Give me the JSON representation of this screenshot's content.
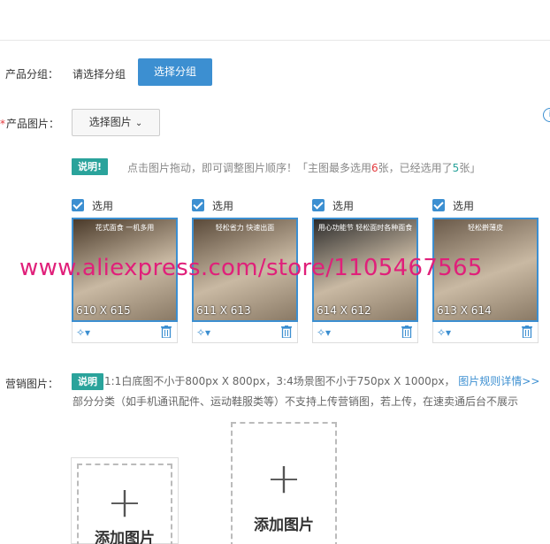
{
  "group": {
    "label": "产品分组：",
    "placeholder_text": "请选择分组",
    "select_button": "选择分组"
  },
  "images": {
    "required_mark": "*",
    "label": "产品图片：",
    "select_button": "选择图片",
    "help_icon": "i",
    "tag": "说明!",
    "hint_prefix": "点击图片拖动，即可调整图片顺序！「主图最多选用",
    "hint_max": "6",
    "hint_mid": "张，已经选用了",
    "hint_used": "5",
    "hint_suffix": "张」",
    "items": [
      {
        "check_label": "选用",
        "dims": "610 X 615",
        "banner": "花式面食 一机多用",
        "color": "#4a3a2a"
      },
      {
        "check_label": "选用",
        "dims": "611 X 613",
        "banner": "轻松省力 快速出面",
        "color": "#5a4a3a"
      },
      {
        "check_label": "选用",
        "dims": "614 X 612",
        "banner": "用心功能节 轻松面时各种面食",
        "color": "#2a2a2a"
      },
      {
        "check_label": "选用",
        "dims": "613 X 614",
        "banner": "轻松擀薄皮",
        "color": "#6a5a4a"
      }
    ]
  },
  "watermark": "www.aliexpress.com/store/1105467565",
  "marketing": {
    "label": "营销图片：",
    "tag": "说明",
    "line1": "1:1白底图不小于800px X 800px，3:4场景图不小于750px X 1000px，",
    "rules_link": "图片规则详情>>",
    "line2": "部分分类（如手机通讯配件、运动鞋服类等）不支持上传营销图，若上传，在速卖通后台不展示",
    "add_label_1": "添加图片",
    "add_label_2": "添加图片"
  },
  "colors": {
    "accent": "#3c8fd1",
    "tag": "#2aa39b",
    "required": "#e4393c",
    "watermark": "#e0207a"
  }
}
